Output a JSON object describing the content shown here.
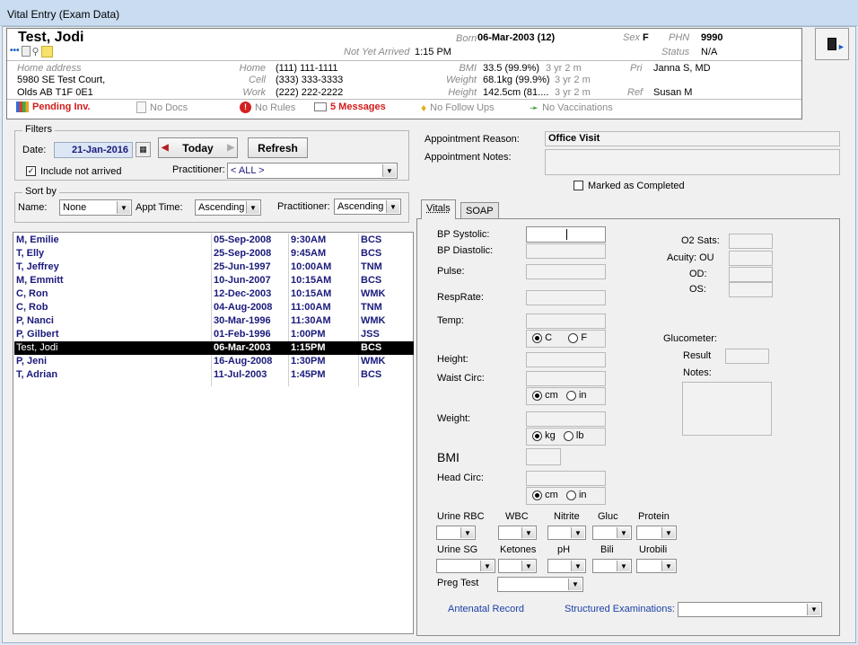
{
  "window": {
    "title": "Vital Entry (Exam Data)"
  },
  "patient": {
    "name": "Test, Jodi",
    "born_label": "Born",
    "born_value": "06-Mar-2003 (12)",
    "sex_label": "Sex",
    "sex_value": "F",
    "phn_label": "PHN",
    "phn_value": "9990",
    "status_label": "Status",
    "status_value": "N/A",
    "arrival_label": "Not Yet Arrived",
    "arrival_time": "1:15 PM",
    "home_address_label": "Home address",
    "address_line1": "5980 SE Test Court,",
    "address_line2": "Olds AB  T1F 0E1",
    "home_label": "Home",
    "home_phone": "(111) 111-1111",
    "cell_label": "Cell",
    "cell_phone": "(333) 333-3333",
    "work_label": "Work",
    "work_phone": "(222) 222-2222",
    "bmi_label": "BMI",
    "bmi_value": "33.5 (99.9%)",
    "bmi_age": "3 yr 2 m",
    "weight_label": "Weight",
    "weight_value": "68.1kg (99.9%)",
    "weight_age": "3 yr 2 m",
    "height_label": "Height",
    "height_value": "142.5cm (81....",
    "height_age": "3 yr 2 m",
    "pri_label": "Pri",
    "pri_value": "Janna S, MD",
    "ref_label": "Ref",
    "ref_value": "Susan M"
  },
  "indicators": {
    "pending": "Pending Inv.",
    "docs": "No Docs",
    "rules": "No Rules",
    "messages": "5 Messages",
    "followups": "No Follow Ups",
    "vaccinations": "No Vaccinations"
  },
  "filters": {
    "legend": "Filters",
    "date_label": "Date:",
    "date_value": "21-Jan-2016",
    "today_button": "Today",
    "refresh_button": "Refresh",
    "include_not_arrived": "Include not arrived",
    "include_checked": true,
    "practitioner_label": "Practitioner:",
    "practitioner_value": "< ALL >"
  },
  "sort": {
    "legend": "Sort by",
    "name_label": "Name:",
    "name_value": "None",
    "appt_label": "Appt Time:",
    "appt_value": "Ascending",
    "prac_label": "Practitioner:",
    "prac_value": "Ascending"
  },
  "appointments": [
    {
      "name": "M, Emilie",
      "dob": "05-Sep-2008",
      "time": "9:30AM",
      "prac": "BCS"
    },
    {
      "name": "T, Elly",
      "dob": "25-Sep-2008",
      "time": "9:45AM",
      "prac": "BCS"
    },
    {
      "name": "T, Jeffrey",
      "dob": "25-Jun-1997",
      "time": "10:00AM",
      "prac": "TNM"
    },
    {
      "name": "M, Emmitt",
      "dob": "10-Jun-2007",
      "time": "10:15AM",
      "prac": "BCS"
    },
    {
      "name": "C, Ron",
      "dob": "12-Dec-2003",
      "time": "10:15AM",
      "prac": "WMK"
    },
    {
      "name": "C, Rob",
      "dob": "04-Aug-2008",
      "time": "11:00AM",
      "prac": "TNM"
    },
    {
      "name": "P, Nanci",
      "dob": "30-Mar-1996",
      "time": "11:30AM",
      "prac": "WMK"
    },
    {
      "name": "P, Gilbert",
      "dob": "01-Feb-1996",
      "time": "1:00PM",
      "prac": "JSS"
    },
    {
      "name": "Test, Jodi",
      "dob": "06-Mar-2003",
      "time": "1:15PM",
      "prac": "BCS",
      "selected": true
    },
    {
      "name": "P, Jeni",
      "dob": "16-Aug-2008",
      "time": "1:30PM",
      "prac": "WMK"
    },
    {
      "name": "T, Adrian",
      "dob": "11-Jul-2003",
      "time": "1:45PM",
      "prac": "BCS"
    }
  ],
  "appointment": {
    "reason_label": "Appointment Reason:",
    "reason_value": "Office Visit",
    "notes_label": "Appointment Notes:",
    "notes_value": "",
    "marked_completed": "Marked as Completed"
  },
  "tabs": {
    "vitals": "Vitals",
    "soap": "SOAP"
  },
  "vitals": {
    "bp_systolic": "BP Systolic:",
    "bp_diastolic": "BP Diastolic:",
    "pulse": "Pulse:",
    "resp_rate": "RespRate:",
    "temp": "Temp:",
    "temp_c": "C",
    "temp_f": "F",
    "height": "Height:",
    "waist": "Waist Circ:",
    "unit_cm": "cm",
    "unit_in": "in",
    "weight": "Weight:",
    "unit_kg": "kg",
    "unit_lb": "lb",
    "bmi": "BMI",
    "head": "Head Circ:",
    "o2": "O2 Sats:",
    "acuity": "Acuity: OU",
    "od": "OD:",
    "os": "OS:",
    "glucometer": "Glucometer:",
    "result": "Result",
    "notes": "Notes:",
    "urine_rbc": "Urine RBC",
    "wbc": "WBC",
    "nitrite": "Nitrite",
    "gluc": "Gluc",
    "protein": "Protein",
    "urine_sg": "Urine SG",
    "ketones": "Ketones",
    "ph": "pH",
    "bili": "Bili",
    "urobili": "Urobili",
    "preg": "Preg Test",
    "antenatal": "Antenatal Record",
    "structured": "Structured Examinations:"
  }
}
